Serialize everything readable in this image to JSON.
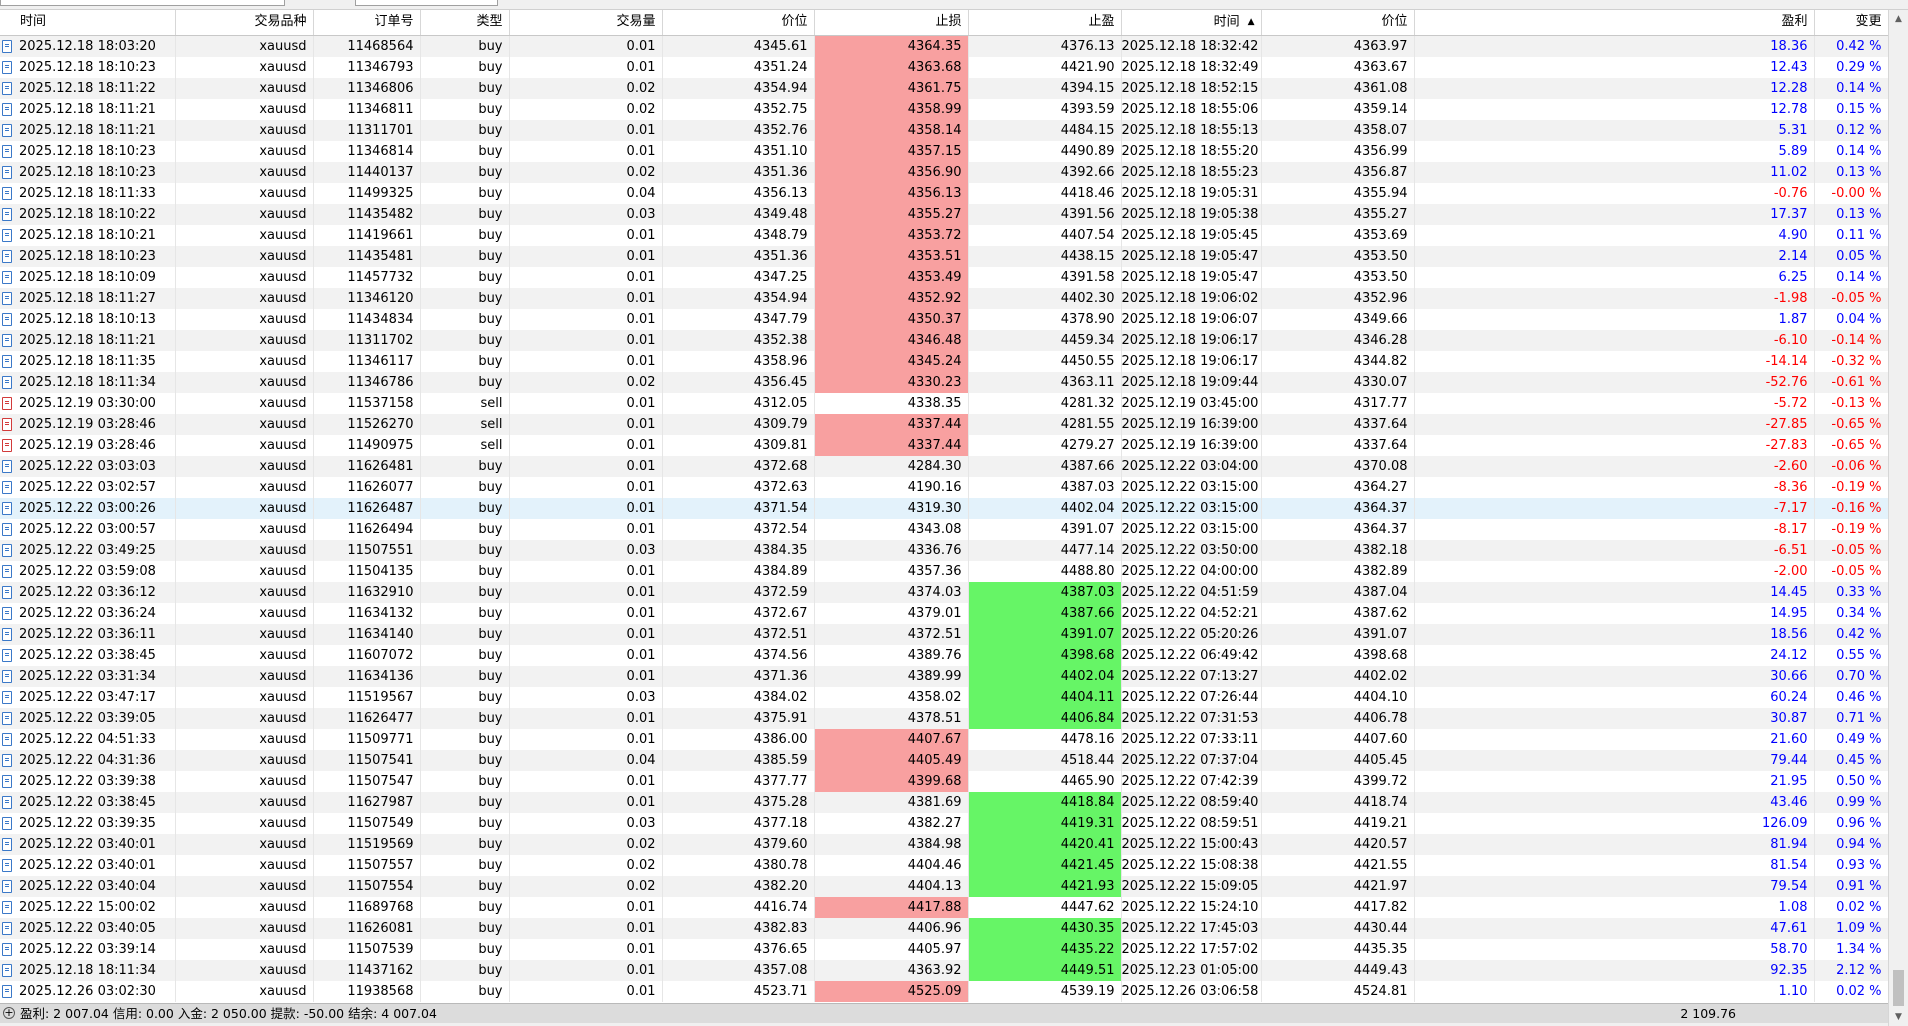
{
  "columns": {
    "open_time": "时间",
    "symbol": "交易品种",
    "ticket": "订单号",
    "type": "类型",
    "volume": "交易量",
    "open_price": "价位",
    "sl": "止损",
    "tp": "止盈",
    "close_time": "时间",
    "close_price": "价位",
    "profit": "盈利",
    "change": "变更"
  },
  "sort_indicator": "▲",
  "rows": [
    {
      "open_time": "2025.12.18 18:03:20",
      "symbol": "xauusd",
      "ticket": "11468564",
      "type": "buy",
      "volume": "0.01",
      "open_price": "4345.61",
      "sl": "4364.35",
      "tp": "4376.13",
      "close_time": "2025.12.18 18:32:42",
      "close_price": "4363.97",
      "profit": "18.36",
      "change": "0.42 %",
      "hit": "sl"
    },
    {
      "open_time": "2025.12.18 18:10:23",
      "symbol": "xauusd",
      "ticket": "11346793",
      "type": "buy",
      "volume": "0.01",
      "open_price": "4351.24",
      "sl": "4363.68",
      "tp": "4421.90",
      "close_time": "2025.12.18 18:32:49",
      "close_price": "4363.67",
      "profit": "12.43",
      "change": "0.29 %",
      "hit": "sl"
    },
    {
      "open_time": "2025.12.18 18:11:22",
      "symbol": "xauusd",
      "ticket": "11346806",
      "type": "buy",
      "volume": "0.02",
      "open_price": "4354.94",
      "sl": "4361.75",
      "tp": "4394.15",
      "close_time": "2025.12.18 18:52:15",
      "close_price": "4361.08",
      "profit": "12.28",
      "change": "0.14 %",
      "hit": "sl"
    },
    {
      "open_time": "2025.12.18 18:11:21",
      "symbol": "xauusd",
      "ticket": "11346811",
      "type": "buy",
      "volume": "0.02",
      "open_price": "4352.75",
      "sl": "4358.99",
      "tp": "4393.59",
      "close_time": "2025.12.18 18:55:06",
      "close_price": "4359.14",
      "profit": "12.78",
      "change": "0.15 %",
      "hit": "sl"
    },
    {
      "open_time": "2025.12.18 18:11:21",
      "symbol": "xauusd",
      "ticket": "11311701",
      "type": "buy",
      "volume": "0.01",
      "open_price": "4352.76",
      "sl": "4358.14",
      "tp": "4484.15",
      "close_time": "2025.12.18 18:55:13",
      "close_price": "4358.07",
      "profit": "5.31",
      "change": "0.12 %",
      "hit": "sl"
    },
    {
      "open_time": "2025.12.18 18:10:23",
      "symbol": "xauusd",
      "ticket": "11346814",
      "type": "buy",
      "volume": "0.01",
      "open_price": "4351.10",
      "sl": "4357.15",
      "tp": "4490.89",
      "close_time": "2025.12.18 18:55:20",
      "close_price": "4356.99",
      "profit": "5.89",
      "change": "0.14 %",
      "hit": "sl"
    },
    {
      "open_time": "2025.12.18 18:10:23",
      "symbol": "xauusd",
      "ticket": "11440137",
      "type": "buy",
      "volume": "0.02",
      "open_price": "4351.36",
      "sl": "4356.90",
      "tp": "4392.66",
      "close_time": "2025.12.18 18:55:23",
      "close_price": "4356.87",
      "profit": "11.02",
      "change": "0.13 %",
      "hit": "sl"
    },
    {
      "open_time": "2025.12.18 18:11:33",
      "symbol": "xauusd",
      "ticket": "11499325",
      "type": "buy",
      "volume": "0.04",
      "open_price": "4356.13",
      "sl": "4356.13",
      "tp": "4418.46",
      "close_time": "2025.12.18 19:05:31",
      "close_price": "4355.94",
      "profit": "-0.76",
      "change": "-0.00 %",
      "hit": "sl"
    },
    {
      "open_time": "2025.12.18 18:10:22",
      "symbol": "xauusd",
      "ticket": "11435482",
      "type": "buy",
      "volume": "0.03",
      "open_price": "4349.48",
      "sl": "4355.27",
      "tp": "4391.56",
      "close_time": "2025.12.18 19:05:38",
      "close_price": "4355.27",
      "profit": "17.37",
      "change": "0.13 %",
      "hit": "sl"
    },
    {
      "open_time": "2025.12.18 18:10:21",
      "symbol": "xauusd",
      "ticket": "11419661",
      "type": "buy",
      "volume": "0.01",
      "open_price": "4348.79",
      "sl": "4353.72",
      "tp": "4407.54",
      "close_time": "2025.12.18 19:05:45",
      "close_price": "4353.69",
      "profit": "4.90",
      "change": "0.11 %",
      "hit": "sl"
    },
    {
      "open_time": "2025.12.18 18:10:23",
      "symbol": "xauusd",
      "ticket": "11435481",
      "type": "buy",
      "volume": "0.01",
      "open_price": "4351.36",
      "sl": "4353.51",
      "tp": "4438.15",
      "close_time": "2025.12.18 19:05:47",
      "close_price": "4353.50",
      "profit": "2.14",
      "change": "0.05 %",
      "hit": "sl"
    },
    {
      "open_time": "2025.12.18 18:10:09",
      "symbol": "xauusd",
      "ticket": "11457732",
      "type": "buy",
      "volume": "0.01",
      "open_price": "4347.25",
      "sl": "4353.49",
      "tp": "4391.58",
      "close_time": "2025.12.18 19:05:47",
      "close_price": "4353.50",
      "profit": "6.25",
      "change": "0.14 %",
      "hit": "sl"
    },
    {
      "open_time": "2025.12.18 18:11:27",
      "symbol": "xauusd",
      "ticket": "11346120",
      "type": "buy",
      "volume": "0.01",
      "open_price": "4354.94",
      "sl": "4352.92",
      "tp": "4402.30",
      "close_time": "2025.12.18 19:06:02",
      "close_price": "4352.96",
      "profit": "-1.98",
      "change": "-0.05 %",
      "hit": "sl"
    },
    {
      "open_time": "2025.12.18 18:10:13",
      "symbol": "xauusd",
      "ticket": "11434834",
      "type": "buy",
      "volume": "0.01",
      "open_price": "4347.79",
      "sl": "4350.37",
      "tp": "4378.90",
      "close_time": "2025.12.18 19:06:07",
      "close_price": "4349.66",
      "profit": "1.87",
      "change": "0.04 %",
      "hit": "sl"
    },
    {
      "open_time": "2025.12.18 18:11:21",
      "symbol": "xauusd",
      "ticket": "11311702",
      "type": "buy",
      "volume": "0.01",
      "open_price": "4352.38",
      "sl": "4346.48",
      "tp": "4459.34",
      "close_time": "2025.12.18 19:06:17",
      "close_price": "4346.28",
      "profit": "-6.10",
      "change": "-0.14 %",
      "hit": "sl"
    },
    {
      "open_time": "2025.12.18 18:11:35",
      "symbol": "xauusd",
      "ticket": "11346117",
      "type": "buy",
      "volume": "0.01",
      "open_price": "4358.96",
      "sl": "4345.24",
      "tp": "4450.55",
      "close_time": "2025.12.18 19:06:17",
      "close_price": "4344.82",
      "profit": "-14.14",
      "change": "-0.32 %",
      "hit": "sl"
    },
    {
      "open_time": "2025.12.18 18:11:34",
      "symbol": "xauusd",
      "ticket": "11346786",
      "type": "buy",
      "volume": "0.02",
      "open_price": "4356.45",
      "sl": "4330.23",
      "tp": "4363.11",
      "close_time": "2025.12.18 19:09:44",
      "close_price": "4330.07",
      "profit": "-52.76",
      "change": "-0.61 %",
      "hit": "sl"
    },
    {
      "open_time": "2025.12.19 03:30:00",
      "symbol": "xauusd",
      "ticket": "11537158",
      "type": "sell",
      "volume": "0.01",
      "open_price": "4312.05",
      "sl": "4338.35",
      "tp": "4281.32",
      "close_time": "2025.12.19 03:45:00",
      "close_price": "4317.77",
      "profit": "-5.72",
      "change": "-0.13 %",
      "hit": ""
    },
    {
      "open_time": "2025.12.19 03:28:46",
      "symbol": "xauusd",
      "ticket": "11526270",
      "type": "sell",
      "volume": "0.01",
      "open_price": "4309.79",
      "sl": "4337.44",
      "tp": "4281.55",
      "close_time": "2025.12.19 16:39:00",
      "close_price": "4337.64",
      "profit": "-27.85",
      "change": "-0.65 %",
      "hit": "sl"
    },
    {
      "open_time": "2025.12.19 03:28:46",
      "symbol": "xauusd",
      "ticket": "11490975",
      "type": "sell",
      "volume": "0.01",
      "open_price": "4309.81",
      "sl": "4337.44",
      "tp": "4279.27",
      "close_time": "2025.12.19 16:39:00",
      "close_price": "4337.64",
      "profit": "-27.83",
      "change": "-0.65 %",
      "hit": "sl"
    },
    {
      "open_time": "2025.12.22 03:03:03",
      "symbol": "xauusd",
      "ticket": "11626481",
      "type": "buy",
      "volume": "0.01",
      "open_price": "4372.68",
      "sl": "4284.30",
      "tp": "4387.66",
      "close_time": "2025.12.22 03:04:00",
      "close_price": "4370.08",
      "profit": "-2.60",
      "change": "-0.06 %",
      "hit": ""
    },
    {
      "open_time": "2025.12.22 03:02:57",
      "symbol": "xauusd",
      "ticket": "11626077",
      "type": "buy",
      "volume": "0.01",
      "open_price": "4372.63",
      "sl": "4190.16",
      "tp": "4387.03",
      "close_time": "2025.12.22 03:15:00",
      "close_price": "4364.27",
      "profit": "-8.36",
      "change": "-0.19 %",
      "hit": ""
    },
    {
      "open_time": "2025.12.22 03:00:26",
      "symbol": "xauusd",
      "ticket": "11626487",
      "type": "buy",
      "volume": "0.01",
      "open_price": "4371.54",
      "sl": "4319.30",
      "tp": "4402.04",
      "close_time": "2025.12.22 03:15:00",
      "close_price": "4364.37",
      "profit": "-7.17",
      "change": "-0.16 %",
      "hit": "",
      "selected": true
    },
    {
      "open_time": "2025.12.22 03:00:57",
      "symbol": "xauusd",
      "ticket": "11626494",
      "type": "buy",
      "volume": "0.01",
      "open_price": "4372.54",
      "sl": "4343.08",
      "tp": "4391.07",
      "close_time": "2025.12.22 03:15:00",
      "close_price": "4364.37",
      "profit": "-8.17",
      "change": "-0.19 %",
      "hit": ""
    },
    {
      "open_time": "2025.12.22 03:49:25",
      "symbol": "xauusd",
      "ticket": "11507551",
      "type": "buy",
      "volume": "0.03",
      "open_price": "4384.35",
      "sl": "4336.76",
      "tp": "4477.14",
      "close_time": "2025.12.22 03:50:00",
      "close_price": "4382.18",
      "profit": "-6.51",
      "change": "-0.05 %",
      "hit": ""
    },
    {
      "open_time": "2025.12.22 03:59:08",
      "symbol": "xauusd",
      "ticket": "11504135",
      "type": "buy",
      "volume": "0.01",
      "open_price": "4384.89",
      "sl": "4357.36",
      "tp": "4488.80",
      "close_time": "2025.12.22 04:00:00",
      "close_price": "4382.89",
      "profit": "-2.00",
      "change": "-0.05 %",
      "hit": ""
    },
    {
      "open_time": "2025.12.22 03:36:12",
      "symbol": "xauusd",
      "ticket": "11632910",
      "type": "buy",
      "volume": "0.01",
      "open_price": "4372.59",
      "sl": "4374.03",
      "tp": "4387.03",
      "close_time": "2025.12.22 04:51:59",
      "close_price": "4387.04",
      "profit": "14.45",
      "change": "0.33 %",
      "hit": "tp"
    },
    {
      "open_time": "2025.12.22 03:36:24",
      "symbol": "xauusd",
      "ticket": "11634132",
      "type": "buy",
      "volume": "0.01",
      "open_price": "4372.67",
      "sl": "4379.01",
      "tp": "4387.66",
      "close_time": "2025.12.22 04:52:21",
      "close_price": "4387.62",
      "profit": "14.95",
      "change": "0.34 %",
      "hit": "tp"
    },
    {
      "open_time": "2025.12.22 03:36:11",
      "symbol": "xauusd",
      "ticket": "11634140",
      "type": "buy",
      "volume": "0.01",
      "open_price": "4372.51",
      "sl": "4372.51",
      "tp": "4391.07",
      "close_time": "2025.12.22 05:20:26",
      "close_price": "4391.07",
      "profit": "18.56",
      "change": "0.42 %",
      "hit": "tp"
    },
    {
      "open_time": "2025.12.22 03:38:45",
      "symbol": "xauusd",
      "ticket": "11607072",
      "type": "buy",
      "volume": "0.01",
      "open_price": "4374.56",
      "sl": "4389.76",
      "tp": "4398.68",
      "close_time": "2025.12.22 06:49:42",
      "close_price": "4398.68",
      "profit": "24.12",
      "change": "0.55 %",
      "hit": "tp"
    },
    {
      "open_time": "2025.12.22 03:31:34",
      "symbol": "xauusd",
      "ticket": "11634136",
      "type": "buy",
      "volume": "0.01",
      "open_price": "4371.36",
      "sl": "4389.99",
      "tp": "4402.04",
      "close_time": "2025.12.22 07:13:27",
      "close_price": "4402.02",
      "profit": "30.66",
      "change": "0.70 %",
      "hit": "tp"
    },
    {
      "open_time": "2025.12.22 03:47:17",
      "symbol": "xauusd",
      "ticket": "11519567",
      "type": "buy",
      "volume": "0.03",
      "open_price": "4384.02",
      "sl": "4358.02",
      "tp": "4404.11",
      "close_time": "2025.12.22 07:26:44",
      "close_price": "4404.10",
      "profit": "60.24",
      "change": "0.46 %",
      "hit": "tp"
    },
    {
      "open_time": "2025.12.22 03:39:05",
      "symbol": "xauusd",
      "ticket": "11626477",
      "type": "buy",
      "volume": "0.01",
      "open_price": "4375.91",
      "sl": "4378.51",
      "tp": "4406.84",
      "close_time": "2025.12.22 07:31:53",
      "close_price": "4406.78",
      "profit": "30.87",
      "change": "0.71 %",
      "hit": "tp"
    },
    {
      "open_time": "2025.12.22 04:51:33",
      "symbol": "xauusd",
      "ticket": "11509771",
      "type": "buy",
      "volume": "0.01",
      "open_price": "4386.00",
      "sl": "4407.67",
      "tp": "4478.16",
      "close_time": "2025.12.22 07:33:11",
      "close_price": "4407.60",
      "profit": "21.60",
      "change": "0.49 %",
      "hit": "sl"
    },
    {
      "open_time": "2025.12.22 04:31:36",
      "symbol": "xauusd",
      "ticket": "11507541",
      "type": "buy",
      "volume": "0.04",
      "open_price": "4385.59",
      "sl": "4405.49",
      "tp": "4518.44",
      "close_time": "2025.12.22 07:37:04",
      "close_price": "4405.45",
      "profit": "79.44",
      "change": "0.45 %",
      "hit": "sl"
    },
    {
      "open_time": "2025.12.22 03:39:38",
      "symbol": "xauusd",
      "ticket": "11507547",
      "type": "buy",
      "volume": "0.01",
      "open_price": "4377.77",
      "sl": "4399.68",
      "tp": "4465.90",
      "close_time": "2025.12.22 07:42:39",
      "close_price": "4399.72",
      "profit": "21.95",
      "change": "0.50 %",
      "hit": "sl"
    },
    {
      "open_time": "2025.12.22 03:38:45",
      "symbol": "xauusd",
      "ticket": "11627987",
      "type": "buy",
      "volume": "0.01",
      "open_price": "4375.28",
      "sl": "4381.69",
      "tp": "4418.84",
      "close_time": "2025.12.22 08:59:40",
      "close_price": "4418.74",
      "profit": "43.46",
      "change": "0.99 %",
      "hit": "tp"
    },
    {
      "open_time": "2025.12.22 03:39:35",
      "symbol": "xauusd",
      "ticket": "11507549",
      "type": "buy",
      "volume": "0.03",
      "open_price": "4377.18",
      "sl": "4382.27",
      "tp": "4419.31",
      "close_time": "2025.12.22 08:59:51",
      "close_price": "4419.21",
      "profit": "126.09",
      "change": "0.96 %",
      "hit": "tp"
    },
    {
      "open_time": "2025.12.22 03:40:01",
      "symbol": "xauusd",
      "ticket": "11519569",
      "type": "buy",
      "volume": "0.02",
      "open_price": "4379.60",
      "sl": "4384.98",
      "tp": "4420.41",
      "close_time": "2025.12.22 15:00:43",
      "close_price": "4420.57",
      "profit": "81.94",
      "change": "0.94 %",
      "hit": "tp"
    },
    {
      "open_time": "2025.12.22 03:40:01",
      "symbol": "xauusd",
      "ticket": "11507557",
      "type": "buy",
      "volume": "0.02",
      "open_price": "4380.78",
      "sl": "4404.46",
      "tp": "4421.45",
      "close_time": "2025.12.22 15:08:38",
      "close_price": "4421.55",
      "profit": "81.54",
      "change": "0.93 %",
      "hit": "tp"
    },
    {
      "open_time": "2025.12.22 03:40:04",
      "symbol": "xauusd",
      "ticket": "11507554",
      "type": "buy",
      "volume": "0.02",
      "open_price": "4382.20",
      "sl": "4404.13",
      "tp": "4421.93",
      "close_time": "2025.12.22 15:09:05",
      "close_price": "4421.97",
      "profit": "79.54",
      "change": "0.91 %",
      "hit": "tp"
    },
    {
      "open_time": "2025.12.22 15:00:02",
      "symbol": "xauusd",
      "ticket": "11689768",
      "type": "buy",
      "volume": "0.01",
      "open_price": "4416.74",
      "sl": "4417.88",
      "tp": "4447.62",
      "close_time": "2025.12.22 15:24:10",
      "close_price": "4417.82",
      "profit": "1.08",
      "change": "0.02 %",
      "hit": "sl"
    },
    {
      "open_time": "2025.12.22 03:40:05",
      "symbol": "xauusd",
      "ticket": "11626081",
      "type": "buy",
      "volume": "0.01",
      "open_price": "4382.83",
      "sl": "4406.96",
      "tp": "4430.35",
      "close_time": "2025.12.22 17:45:03",
      "close_price": "4430.44",
      "profit": "47.61",
      "change": "1.09 %",
      "hit": "tp"
    },
    {
      "open_time": "2025.12.22 03:39:14",
      "symbol": "xauusd",
      "ticket": "11507539",
      "type": "buy",
      "volume": "0.01",
      "open_price": "4376.65",
      "sl": "4405.97",
      "tp": "4435.22",
      "close_time": "2025.12.22 17:57:02",
      "close_price": "4435.35",
      "profit": "58.70",
      "change": "1.34 %",
      "hit": "tp"
    },
    {
      "open_time": "2025.12.18 18:11:34",
      "symbol": "xauusd",
      "ticket": "11437162",
      "type": "buy",
      "volume": "0.01",
      "open_price": "4357.08",
      "sl": "4363.92",
      "tp": "4449.51",
      "close_time": "2025.12.23 01:05:00",
      "close_price": "4449.43",
      "profit": "92.35",
      "change": "2.12 %",
      "hit": "tp"
    },
    {
      "open_time": "2025.12.26 03:02:30",
      "symbol": "xauusd",
      "ticket": "11938568",
      "type": "buy",
      "volume": "0.01",
      "open_price": "4523.71",
      "sl": "4525.09",
      "tp": "4539.19",
      "close_time": "2025.12.26 03:06:58",
      "close_price": "4524.81",
      "profit": "1.10",
      "change": "0.02 %",
      "hit": "sl"
    }
  ],
  "footer": {
    "summary": "盈利: 2 007.04  信用: 0.00  入金: 2 050.00  提款: -50.00  结余: 4 007.04",
    "total_profit": "2 109.76",
    "expand_glyph": "+"
  },
  "colors": {
    "sl_hit_bg": "#f8a0a0",
    "tp_hit_bg": "#66f566",
    "negative_text": "#ff0000",
    "positive_text": "#0000ff",
    "selected_row_bg": "#e3f2fb"
  },
  "icons": {
    "buy_row": "deal-buy-icon",
    "sell_row": "deal-sell-icon",
    "footer": "expand-plus-icon",
    "scroll_up": "scroll-up-arrow-icon",
    "scroll_down": "scroll-down-arrow-icon"
  }
}
